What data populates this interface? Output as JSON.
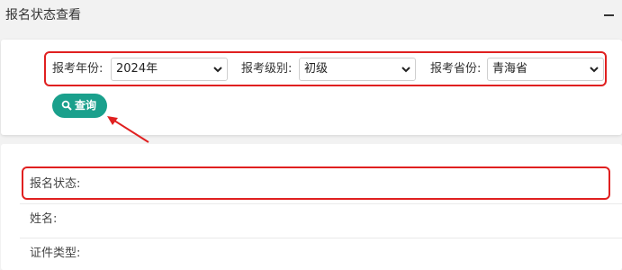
{
  "header": {
    "title": "报名状态查看",
    "collapse_icon": "minus-icon"
  },
  "filters": {
    "year_label": "报考年份:",
    "year_value": "2024年",
    "level_label": "报考级别:",
    "level_value": "初级",
    "province_label": "报考省份:",
    "province_value": "青海省"
  },
  "query_button": {
    "label": "查询",
    "icon": "search-icon"
  },
  "results": {
    "status_label": "报名状态:",
    "name_label": "姓名:",
    "id_type_label": "证件类型:"
  },
  "colors": {
    "accent": "#1aa08c",
    "highlight": "#e02020"
  }
}
